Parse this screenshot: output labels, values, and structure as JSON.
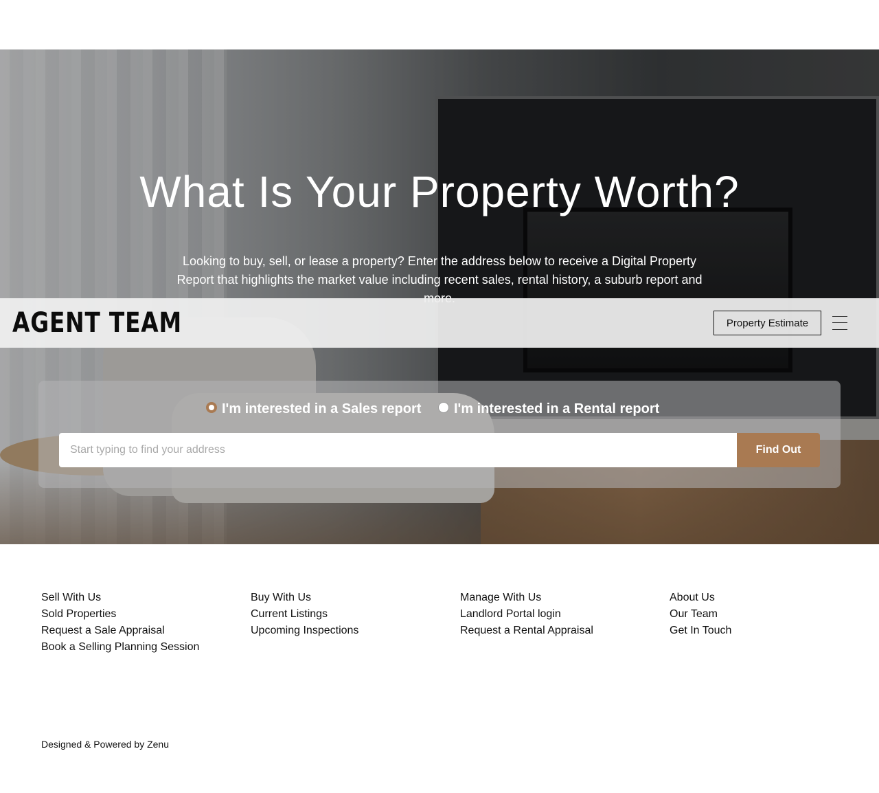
{
  "hero": {
    "title": "What Is Your Property Worth?",
    "description": "Looking to buy, sell, or lease a property? Enter the address below to receive a Digital Property Report that highlights the market value including recent sales, rental history, a suburb report and more."
  },
  "header": {
    "logo_text": "AGENT TEAM",
    "estimate_button": "Property Estimate",
    "menu_icon": "hamburger-menu-icon"
  },
  "search": {
    "options": [
      {
        "label": "I'm interested in a Sales report",
        "selected": true
      },
      {
        "label": "I'm interested in a Rental report",
        "selected": false
      }
    ],
    "placeholder": "Start typing to find your address",
    "button_label": "Find Out"
  },
  "footer": {
    "columns": [
      {
        "links": [
          "Sell With Us",
          "Sold Properties",
          "Request a Sale Appraisal",
          "Book a Selling Planning Session"
        ]
      },
      {
        "links": [
          "Buy With Us",
          "Current Listings",
          "Upcoming Inspections"
        ]
      },
      {
        "links": [
          "Manage With Us",
          "Landlord Portal login",
          "Request a Rental Appraisal"
        ]
      },
      {
        "links": [
          "About Us",
          "Our Team",
          "Get In Touch"
        ]
      }
    ],
    "credit": "Designed & Powered by Zenu"
  },
  "colors": {
    "accent": "#a97a52",
    "header_bg": "#f0f0f0",
    "text": "#111111"
  }
}
